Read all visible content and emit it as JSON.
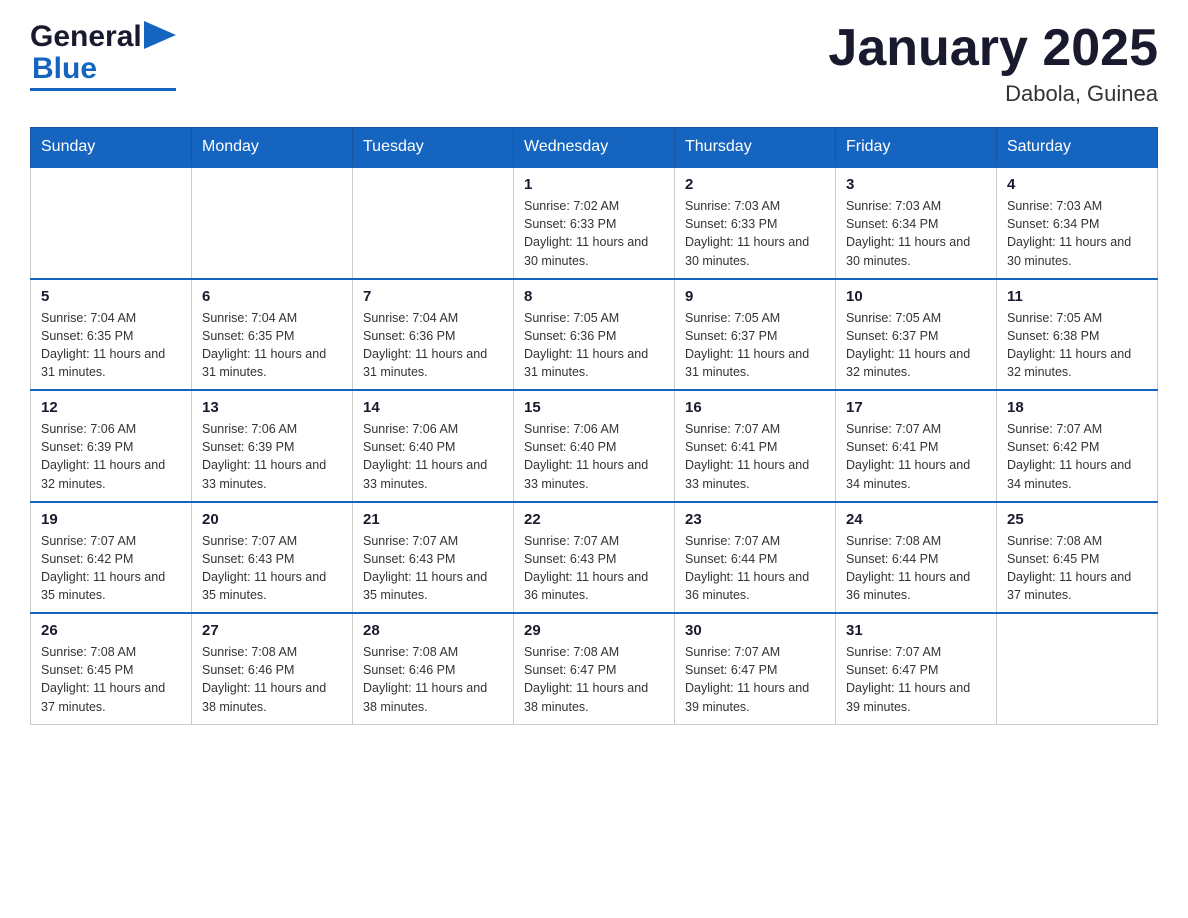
{
  "logo": {
    "general": "General",
    "blue": "Blue"
  },
  "title": {
    "month_year": "January 2025",
    "location": "Dabola, Guinea"
  },
  "weekdays": [
    "Sunday",
    "Monday",
    "Tuesday",
    "Wednesday",
    "Thursday",
    "Friday",
    "Saturday"
  ],
  "weeks": [
    [
      {
        "day": "",
        "info": ""
      },
      {
        "day": "",
        "info": ""
      },
      {
        "day": "",
        "info": ""
      },
      {
        "day": "1",
        "info": "Sunrise: 7:02 AM\nSunset: 6:33 PM\nDaylight: 11 hours and 30 minutes."
      },
      {
        "day": "2",
        "info": "Sunrise: 7:03 AM\nSunset: 6:33 PM\nDaylight: 11 hours and 30 minutes."
      },
      {
        "day": "3",
        "info": "Sunrise: 7:03 AM\nSunset: 6:34 PM\nDaylight: 11 hours and 30 minutes."
      },
      {
        "day": "4",
        "info": "Sunrise: 7:03 AM\nSunset: 6:34 PM\nDaylight: 11 hours and 30 minutes."
      }
    ],
    [
      {
        "day": "5",
        "info": "Sunrise: 7:04 AM\nSunset: 6:35 PM\nDaylight: 11 hours and 31 minutes."
      },
      {
        "day": "6",
        "info": "Sunrise: 7:04 AM\nSunset: 6:35 PM\nDaylight: 11 hours and 31 minutes."
      },
      {
        "day": "7",
        "info": "Sunrise: 7:04 AM\nSunset: 6:36 PM\nDaylight: 11 hours and 31 minutes."
      },
      {
        "day": "8",
        "info": "Sunrise: 7:05 AM\nSunset: 6:36 PM\nDaylight: 11 hours and 31 minutes."
      },
      {
        "day": "9",
        "info": "Sunrise: 7:05 AM\nSunset: 6:37 PM\nDaylight: 11 hours and 31 minutes."
      },
      {
        "day": "10",
        "info": "Sunrise: 7:05 AM\nSunset: 6:37 PM\nDaylight: 11 hours and 32 minutes."
      },
      {
        "day": "11",
        "info": "Sunrise: 7:05 AM\nSunset: 6:38 PM\nDaylight: 11 hours and 32 minutes."
      }
    ],
    [
      {
        "day": "12",
        "info": "Sunrise: 7:06 AM\nSunset: 6:39 PM\nDaylight: 11 hours and 32 minutes."
      },
      {
        "day": "13",
        "info": "Sunrise: 7:06 AM\nSunset: 6:39 PM\nDaylight: 11 hours and 33 minutes."
      },
      {
        "day": "14",
        "info": "Sunrise: 7:06 AM\nSunset: 6:40 PM\nDaylight: 11 hours and 33 minutes."
      },
      {
        "day": "15",
        "info": "Sunrise: 7:06 AM\nSunset: 6:40 PM\nDaylight: 11 hours and 33 minutes."
      },
      {
        "day": "16",
        "info": "Sunrise: 7:07 AM\nSunset: 6:41 PM\nDaylight: 11 hours and 33 minutes."
      },
      {
        "day": "17",
        "info": "Sunrise: 7:07 AM\nSunset: 6:41 PM\nDaylight: 11 hours and 34 minutes."
      },
      {
        "day": "18",
        "info": "Sunrise: 7:07 AM\nSunset: 6:42 PM\nDaylight: 11 hours and 34 minutes."
      }
    ],
    [
      {
        "day": "19",
        "info": "Sunrise: 7:07 AM\nSunset: 6:42 PM\nDaylight: 11 hours and 35 minutes."
      },
      {
        "day": "20",
        "info": "Sunrise: 7:07 AM\nSunset: 6:43 PM\nDaylight: 11 hours and 35 minutes."
      },
      {
        "day": "21",
        "info": "Sunrise: 7:07 AM\nSunset: 6:43 PM\nDaylight: 11 hours and 35 minutes."
      },
      {
        "day": "22",
        "info": "Sunrise: 7:07 AM\nSunset: 6:43 PM\nDaylight: 11 hours and 36 minutes."
      },
      {
        "day": "23",
        "info": "Sunrise: 7:07 AM\nSunset: 6:44 PM\nDaylight: 11 hours and 36 minutes."
      },
      {
        "day": "24",
        "info": "Sunrise: 7:08 AM\nSunset: 6:44 PM\nDaylight: 11 hours and 36 minutes."
      },
      {
        "day": "25",
        "info": "Sunrise: 7:08 AM\nSunset: 6:45 PM\nDaylight: 11 hours and 37 minutes."
      }
    ],
    [
      {
        "day": "26",
        "info": "Sunrise: 7:08 AM\nSunset: 6:45 PM\nDaylight: 11 hours and 37 minutes."
      },
      {
        "day": "27",
        "info": "Sunrise: 7:08 AM\nSunset: 6:46 PM\nDaylight: 11 hours and 38 minutes."
      },
      {
        "day": "28",
        "info": "Sunrise: 7:08 AM\nSunset: 6:46 PM\nDaylight: 11 hours and 38 minutes."
      },
      {
        "day": "29",
        "info": "Sunrise: 7:08 AM\nSunset: 6:47 PM\nDaylight: 11 hours and 38 minutes."
      },
      {
        "day": "30",
        "info": "Sunrise: 7:07 AM\nSunset: 6:47 PM\nDaylight: 11 hours and 39 minutes."
      },
      {
        "day": "31",
        "info": "Sunrise: 7:07 AM\nSunset: 6:47 PM\nDaylight: 11 hours and 39 minutes."
      },
      {
        "day": "",
        "info": ""
      }
    ]
  ]
}
